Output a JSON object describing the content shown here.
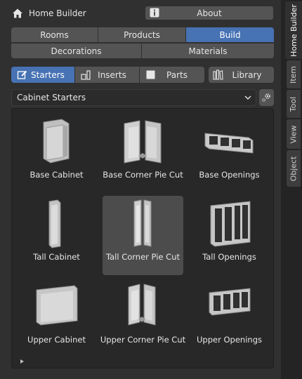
{
  "header": {
    "title": "Home Builder",
    "about_label": "About"
  },
  "tabs_row1": [
    {
      "label": "Rooms",
      "active": false
    },
    {
      "label": "Products",
      "active": false
    },
    {
      "label": "Build",
      "active": true
    }
  ],
  "tabs_row2": [
    {
      "label": "Decorations"
    },
    {
      "label": "Materials"
    }
  ],
  "categories": [
    {
      "label": "Starters",
      "icon": "pencil-icon",
      "active": true
    },
    {
      "label": "Inserts",
      "icon": "insert-icon",
      "active": false
    },
    {
      "label": "Parts",
      "icon": "square-icon",
      "active": false
    }
  ],
  "library_label": "Library",
  "dropdown": {
    "value": "Cabinet Starters"
  },
  "assets": [
    {
      "name": "Base Cabinet"
    },
    {
      "name": "Base Corner Pie Cut"
    },
    {
      "name": "Base Openings"
    },
    {
      "name": "Tall Cabinet"
    },
    {
      "name": "Tall Corner Pie Cut",
      "selected": true
    },
    {
      "name": "Tall Openings"
    },
    {
      "name": "Upper Cabinet"
    },
    {
      "name": "Upper Corner Pie Cut"
    },
    {
      "name": "Upper Openings"
    }
  ],
  "side_tabs": [
    {
      "label": "Home Builder",
      "active": true
    },
    {
      "label": "Item"
    },
    {
      "label": "Tool"
    },
    {
      "label": "View"
    },
    {
      "label": "Object"
    }
  ],
  "colors": {
    "accent": "#4772b3",
    "panel": "#303030",
    "button": "#545454",
    "grid": "#282828"
  }
}
